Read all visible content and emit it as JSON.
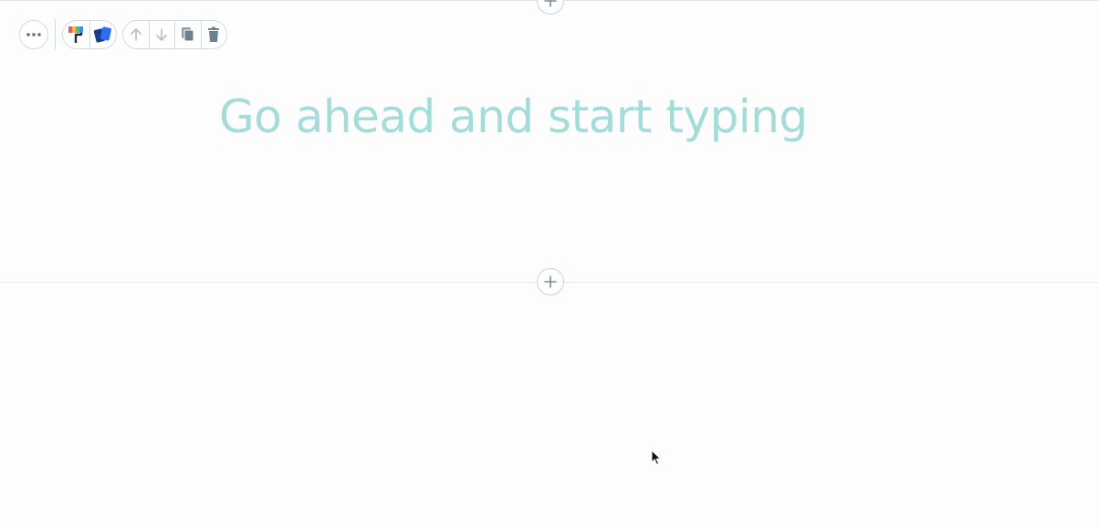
{
  "editor": {
    "placeholder": "Go ahead and start typing"
  },
  "toolbar": {
    "more_icon": "more-horizontal-icon",
    "style_buttons": [
      "paint-roller-icon",
      "color-cards-icon"
    ],
    "action_buttons": [
      "arrow-up-icon",
      "arrow-down-icon",
      "duplicate-icon",
      "trash-icon"
    ]
  },
  "section_controls": {
    "add_icon": "plus-icon"
  },
  "colors": {
    "placeholder_text": "#a4dcd9",
    "border": "#d3dbe2",
    "icon": "#7a8d9a",
    "background": "#fdfdfd"
  }
}
